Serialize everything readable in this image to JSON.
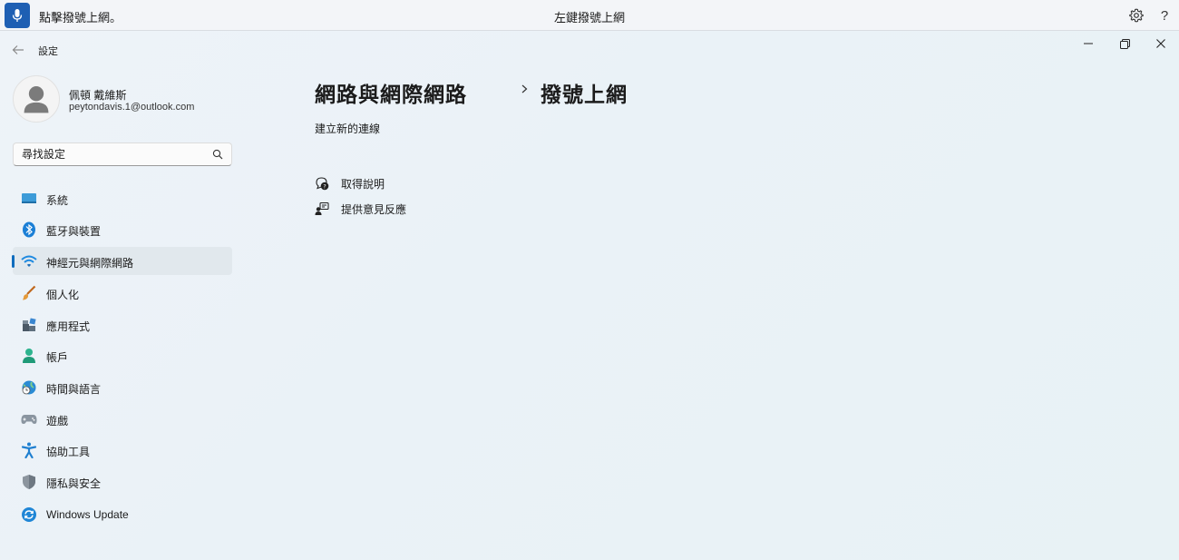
{
  "voice_bar": {
    "status": "點擊撥號上網。",
    "hint": "左鍵撥號上網"
  },
  "app": {
    "title": "設定"
  },
  "user": {
    "name": "佩頓 戴維斯",
    "email": "peytondavis.1@outlook.com"
  },
  "search": {
    "placeholder": "尋找設定"
  },
  "nav": {
    "items": [
      {
        "label": "系統",
        "icon": "system-icon"
      },
      {
        "label": "藍牙與裝置",
        "icon": "bluetooth-icon"
      },
      {
        "label": "神經元與網際網路",
        "icon": "wifi-icon",
        "selected": true
      },
      {
        "label": "個人化",
        "icon": "brush-icon"
      },
      {
        "label": "應用程式",
        "icon": "apps-icon"
      },
      {
        "label": "帳戶",
        "icon": "account-icon"
      },
      {
        "label": "時間與語言",
        "icon": "time-language-icon"
      },
      {
        "label": "遊戲",
        "icon": "gamepad-icon"
      },
      {
        "label": "協助工具",
        "icon": "accessibility-icon"
      },
      {
        "label": "隱私與安全",
        "icon": "shield-icon"
      },
      {
        "label": "Windows Update",
        "icon": "update-icon"
      }
    ]
  },
  "main": {
    "breadcrumb_parent": "網路與網際網路",
    "breadcrumb_current": "撥號上網",
    "new_connection": "建立新的連線",
    "links": [
      {
        "label": "取得說明",
        "icon": "help-chat-icon"
      },
      {
        "label": "提供意見反應",
        "icon": "feedback-icon"
      }
    ]
  },
  "colors": {
    "accent": "#0f6cbd",
    "mic": "#1e5fb3"
  }
}
